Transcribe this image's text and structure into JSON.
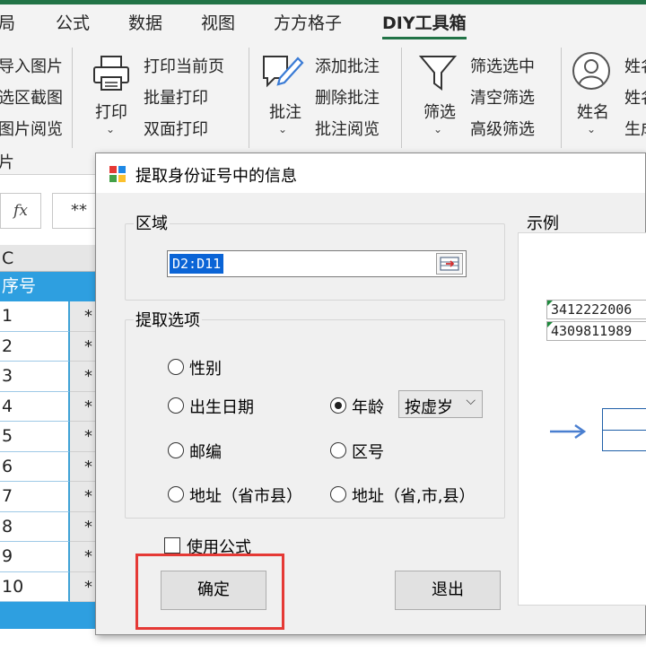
{
  "ribbon_tabs": [
    {
      "label": "局"
    },
    {
      "label": "公式"
    },
    {
      "label": "数据"
    },
    {
      "label": "视图"
    },
    {
      "label": "方方格子"
    },
    {
      "label": "DIY工具箱",
      "active": true
    }
  ],
  "ribbon": {
    "group1": {
      "items": [
        "导入图片",
        "选区截图",
        "图片阅览",
        "片"
      ]
    },
    "print": {
      "label": "打印",
      "items": [
        "打印当前页",
        "批量打印",
        "双面打印"
      ]
    },
    "comment": {
      "label": "批注",
      "items": [
        "添加批注",
        "删除批注",
        "批注阅览"
      ]
    },
    "filter": {
      "label": "筛选",
      "items": [
        "筛选选中",
        "清空筛选",
        "高级筛选"
      ]
    },
    "name": {
      "label": "姓名",
      "items": [
        "姓名",
        "姓名",
        "生成"
      ]
    }
  },
  "formula_bar": {
    "fx": "fx",
    "value": "**"
  },
  "sheet": {
    "col_header": "C",
    "header_cell": "序号",
    "rows": [
      "1",
      "2",
      "3",
      "4",
      "5",
      "6",
      "7",
      "8",
      "9",
      "10"
    ],
    "masked": "*"
  },
  "dialog": {
    "title": "提取身份证号中的信息",
    "region_label": "区域",
    "region_value": "D2:D11",
    "options_label": "提取选项",
    "options": {
      "gender": "性别",
      "birth_date": "出生日期",
      "age": "年龄",
      "postcode": "邮编",
      "area_code": "区号",
      "address1": "地址（省市县）",
      "address2": "地址（省,市,县）"
    },
    "age_mode": "按虚岁",
    "use_formula": "使用公式",
    "ok": "确定",
    "exit": "退出",
    "example_label": "示例",
    "example_values": [
      "3412222006",
      "4309811989"
    ]
  },
  "colors": {
    "excel_green": "#217346",
    "header_blue": "#2e9fe0",
    "highlight_red": "#e53935",
    "selection_blue": "#0a64d6"
  }
}
